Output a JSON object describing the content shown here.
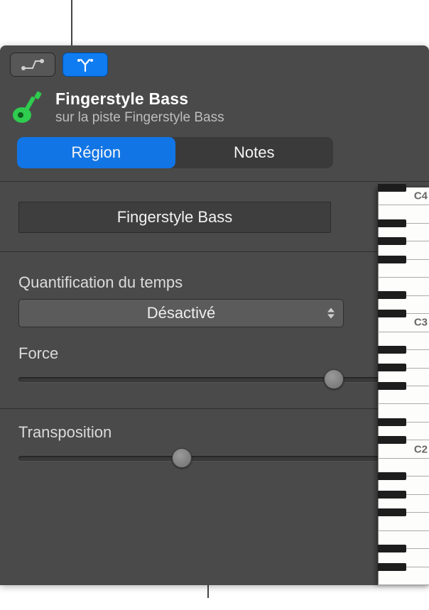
{
  "header": {
    "title": "Fingerstyle Bass",
    "subtitle": "sur la piste Fingerstyle Bass"
  },
  "tabs": {
    "region": "Région",
    "notes": "Notes"
  },
  "region": {
    "name": "Fingerstyle Bass"
  },
  "quantize": {
    "label": "Quantification du temps",
    "value": "Désactivé"
  },
  "strength": {
    "label": "Force",
    "value": "100"
  },
  "transpose": {
    "label": "Transposition",
    "value": "0"
  },
  "piano": {
    "c4": "C4",
    "c3": "C3",
    "c2": "C2"
  }
}
